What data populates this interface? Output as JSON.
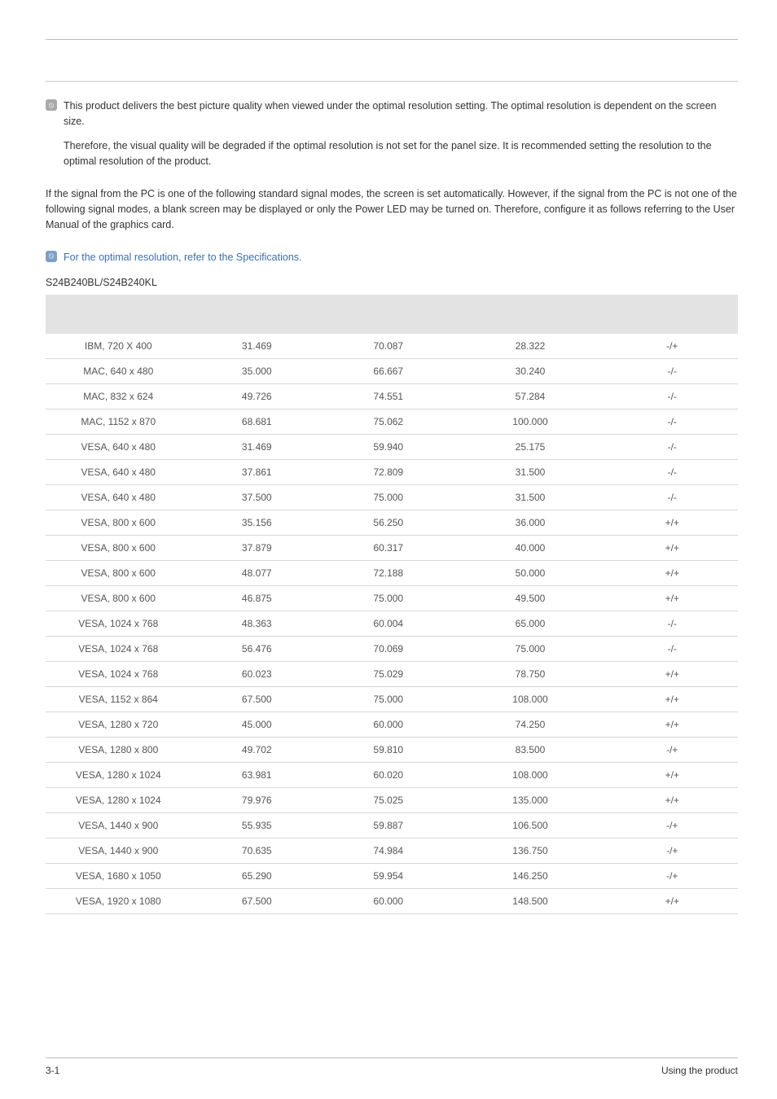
{
  "notes": {
    "intro1": "This product delivers the best picture quality when viewed under the optimal resolution setting. The optimal resolution is dependent on the screen size.",
    "intro2": "Therefore, the visual quality will be degraded if the optimal resolution is not set for the panel size. It is recommended setting the resolution to the optimal resolution of the product."
  },
  "body_para": "If the signal from the PC is one of the following standard signal modes, the screen is set automatically. However, if the signal from the PC is not one of the following signal modes, a blank screen may be displayed or only the Power LED may be turned on. Therefore, configure it as follows referring to the User Manual of the graphics card.",
  "spec_note": "For the optimal resolution, refer to the Specifications.",
  "model": "S24B240BL/S24B240KL",
  "table": {
    "columns": [
      "",
      "",
      "",
      "",
      ""
    ],
    "rows": [
      [
        "IBM, 720 X 400",
        "31.469",
        "70.087",
        "28.322",
        "-/+"
      ],
      [
        "MAC, 640 x 480",
        "35.000",
        "66.667",
        "30.240",
        "-/-"
      ],
      [
        "MAC, 832 x 624",
        "49.726",
        "74.551",
        "57.284",
        "-/-"
      ],
      [
        "MAC, 1152 x 870",
        "68.681",
        "75.062",
        "100.000",
        "-/-"
      ],
      [
        "VESA, 640 x 480",
        "31.469",
        "59.940",
        "25.175",
        "-/-"
      ],
      [
        "VESA, 640 x 480",
        "37.861",
        "72.809",
        "31.500",
        "-/-"
      ],
      [
        "VESA, 640 x 480",
        "37.500",
        "75.000",
        "31.500",
        "-/-"
      ],
      [
        "VESA, 800 x 600",
        "35.156",
        "56.250",
        "36.000",
        "+/+"
      ],
      [
        "VESA, 800 x 600",
        "37.879",
        "60.317",
        "40.000",
        "+/+"
      ],
      [
        "VESA, 800 x 600",
        "48.077",
        "72.188",
        "50.000",
        "+/+"
      ],
      [
        "VESA, 800 x 600",
        "46.875",
        "75.000",
        "49.500",
        "+/+"
      ],
      [
        "VESA, 1024 x 768",
        "48.363",
        "60.004",
        "65.000",
        "-/-"
      ],
      [
        "VESA, 1024 x 768",
        "56.476",
        "70.069",
        "75.000",
        "-/-"
      ],
      [
        "VESA, 1024 x 768",
        "60.023",
        "75.029",
        "78.750",
        "+/+"
      ],
      [
        "VESA, 1152 x 864",
        "67.500",
        "75.000",
        "108.000",
        "+/+"
      ],
      [
        "VESA, 1280 x 720",
        "45.000",
        "60.000",
        "74.250",
        "+/+"
      ],
      [
        "VESA, 1280 x 800",
        "49.702",
        "59.810",
        "83.500",
        "-/+"
      ],
      [
        "VESA, 1280 x 1024",
        "63.981",
        "60.020",
        "108.000",
        "+/+"
      ],
      [
        "VESA, 1280 x 1024",
        "79.976",
        "75.025",
        "135.000",
        "+/+"
      ],
      [
        "VESA, 1440 x 900",
        "55.935",
        "59.887",
        "106.500",
        "-/+"
      ],
      [
        "VESA, 1440 x 900",
        "70.635",
        "74.984",
        "136.750",
        "-/+"
      ],
      [
        "VESA, 1680 x 1050",
        "65.290",
        "59.954",
        "146.250",
        "-/+"
      ],
      [
        "VESA, 1920 x 1080",
        "67.500",
        "60.000",
        "148.500",
        "+/+"
      ]
    ]
  },
  "footer": {
    "left": "3-1",
    "right": "Using the product"
  },
  "icons": {
    "note_glyph": "⦸"
  }
}
